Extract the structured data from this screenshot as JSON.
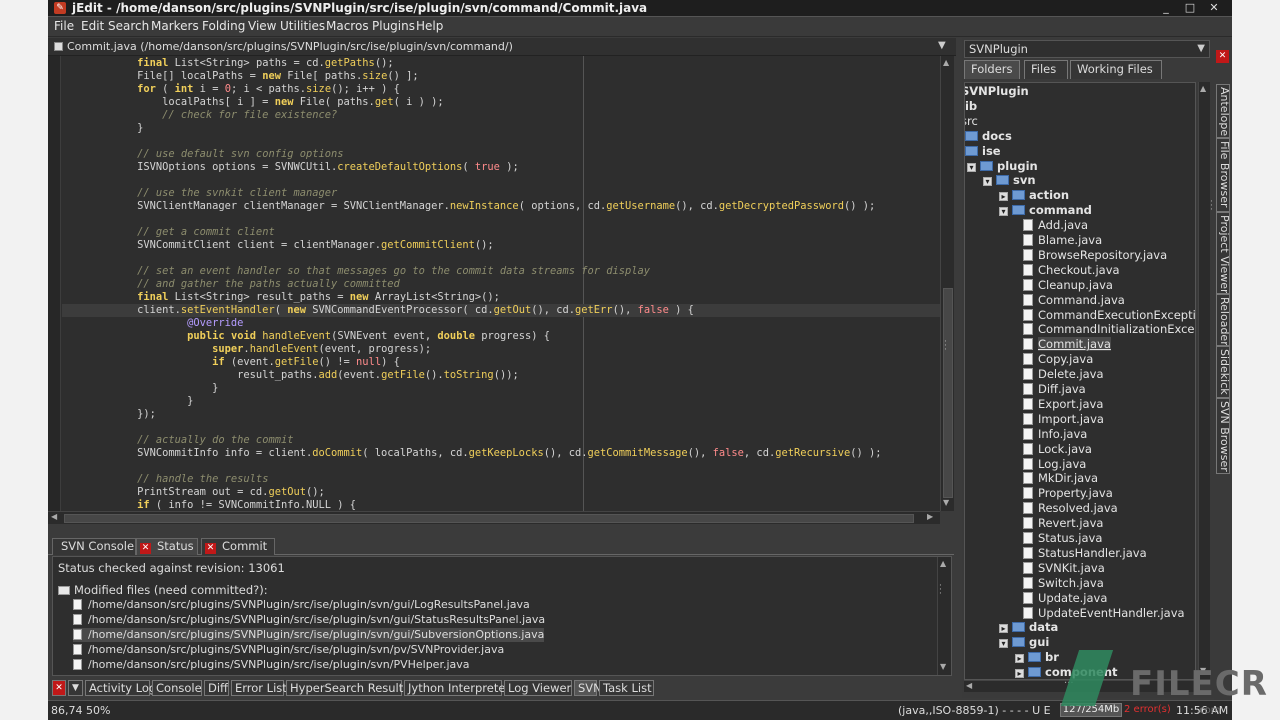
{
  "window": {
    "title": "jEdit - /home/danson/src/plugins/SVNPlugin/src/ise/plugin/svn/command/Commit.java",
    "app_icon": "jedit-logo-icon",
    "controls": [
      "_",
      "□",
      "✕"
    ]
  },
  "menu": [
    "File",
    "Edit",
    "Search",
    "Markers",
    "Folding",
    "View",
    "Utilities",
    "Macros",
    "Plugins",
    "Help"
  ],
  "buffer": {
    "path": "Commit.java (/home/danson/src/plugins/SVNPlugin/src/ise/plugin/svn/command/)"
  },
  "code_lines": [
    "            final List<String> paths = cd.getPaths();",
    "            File[] localPaths = new File[ paths.size() ];",
    "            for ( int i = 0; i < paths.size(); i++ ) {",
    "                localPaths[ i ] = new File( paths.get( i ) );",
    "                // check for file existence?",
    "            }",
    "",
    "            // use default svn config options",
    "            ISVNOptions options = SVNWCUtil.createDefaultOptions( true );",
    "",
    "            // use the svnkit client manager",
    "            SVNClientManager clientManager = SVNClientManager.newInstance( options, cd.getUsername(), cd.getDecryptedPassword() );",
    "",
    "            // get a commit client",
    "            SVNCommitClient client = clientManager.getCommitClient();",
    "",
    "            // set an event handler so that messages go to the commit data streams for display",
    "            // and gather the paths actually committed",
    "            final List<String> result_paths = new ArrayList<String>();",
    "            client.setEventHandler( new SVNCommandEventProcessor( cd.getOut(), cd.getErr(), false ) {",
    "                    @Override",
    "                    public void handleEvent(SVNEvent event, double progress) {",
    "                        super.handleEvent(event, progress);",
    "                        if (event.getFile() != null) {",
    "                            result_paths.add(event.getFile().toString());",
    "                        }",
    "                    }",
    "            });",
    "",
    "            // actually do the commit",
    "            SVNCommitInfo info = client.doCommit( localPaths, cd.getKeepLocks(), cd.getCommitMessage(), false, cd.getRecursive() );",
    "",
    "            // handle the results",
    "            PrintStream out = cd.getOut();",
    "            if ( info != SVNCommitInfo.NULL ) {"
  ],
  "highlight_line": 19,
  "bottom_tabs": [
    {
      "label": "SVN Console",
      "closable": false
    },
    {
      "label": "Status",
      "closable": true
    },
    {
      "label": "Commit",
      "closable": true
    }
  ],
  "status_panel": {
    "header": "Status checked against revision: 13061",
    "modified_label": "Modified files (need committed?):",
    "files": [
      "/home/danson/src/plugins/SVNPlugin/src/ise/plugin/svn/gui/LogResultsPanel.java",
      "/home/danson/src/plugins/SVNPlugin/src/ise/plugin/svn/gui/StatusResultsPanel.java",
      "/home/danson/src/plugins/SVNPlugin/src/ise/plugin/svn/gui/SubversionOptions.java",
      "/home/danson/src/plugins/SVNPlugin/src/ise/plugin/svn/pv/SVNProvider.java",
      "/home/danson/src/plugins/SVNPlugin/src/ise/plugin/svn/PVHelper.java"
    ],
    "selected_file": 2
  },
  "dock_buttons": [
    "Activity Log",
    "Console",
    "Diff",
    "Error List",
    "HyperSearch Results",
    "Jython Interpreter",
    "Log Viewer",
    "SVN",
    "Task List"
  ],
  "dock_selected": "SVN",
  "statusbar": {
    "position": "86,74 50%",
    "encoding": "(java,,ISO-8859-1)",
    "flags": "- - - - U E",
    "memory": "127/254Mb",
    "errors": "2 error(s)",
    "time": "11:56 AM"
  },
  "right_panel": {
    "plugin": "SVNPlugin",
    "tabs": [
      "Folders",
      "Files",
      "Working Files"
    ],
    "selected_tab": "Folders",
    "tree": [
      {
        "label": "SVNPlugin",
        "depth": 0,
        "kind": "text",
        "bold": true
      },
      {
        "label": "lib",
        "depth": 0,
        "kind": "text",
        "bold": true
      },
      {
        "label": "src",
        "depth": 0,
        "kind": "text",
        "bold": false
      },
      {
        "label": "docs",
        "depth": 0,
        "kind": "folder",
        "bold": true,
        "toggle": ""
      },
      {
        "label": "ise",
        "depth": 0,
        "kind": "folder",
        "bold": true,
        "toggle": ""
      },
      {
        "label": "plugin",
        "depth": 1,
        "kind": "folder",
        "bold": true,
        "toggle": "-"
      },
      {
        "label": "svn",
        "depth": 2,
        "kind": "folder",
        "bold": true,
        "toggle": "-"
      },
      {
        "label": "action",
        "depth": 3,
        "kind": "folder",
        "bold": true,
        "toggle": "+"
      },
      {
        "label": "command",
        "depth": 3,
        "kind": "folder",
        "bold": true,
        "toggle": "-"
      },
      {
        "label": "Add.java",
        "depth": 4,
        "kind": "file"
      },
      {
        "label": "Blame.java",
        "depth": 4,
        "kind": "file"
      },
      {
        "label": "BrowseRepository.java",
        "depth": 4,
        "kind": "file"
      },
      {
        "label": "Checkout.java",
        "depth": 4,
        "kind": "file"
      },
      {
        "label": "Cleanup.java",
        "depth": 4,
        "kind": "file"
      },
      {
        "label": "Command.java",
        "depth": 4,
        "kind": "file"
      },
      {
        "label": "CommandExecutionExceptio",
        "depth": 4,
        "kind": "file"
      },
      {
        "label": "CommandInitializationExcept",
        "depth": 4,
        "kind": "file"
      },
      {
        "label": "Commit.java",
        "depth": 4,
        "kind": "file",
        "selected": true
      },
      {
        "label": "Copy.java",
        "depth": 4,
        "kind": "file"
      },
      {
        "label": "Delete.java",
        "depth": 4,
        "kind": "file"
      },
      {
        "label": "Diff.java",
        "depth": 4,
        "kind": "file"
      },
      {
        "label": "Export.java",
        "depth": 4,
        "kind": "file"
      },
      {
        "label": "Import.java",
        "depth": 4,
        "kind": "file"
      },
      {
        "label": "Info.java",
        "depth": 4,
        "kind": "file"
      },
      {
        "label": "Lock.java",
        "depth": 4,
        "kind": "file"
      },
      {
        "label": "Log.java",
        "depth": 4,
        "kind": "file"
      },
      {
        "label": "MkDir.java",
        "depth": 4,
        "kind": "file"
      },
      {
        "label": "Property.java",
        "depth": 4,
        "kind": "file"
      },
      {
        "label": "Resolved.java",
        "depth": 4,
        "kind": "file"
      },
      {
        "label": "Revert.java",
        "depth": 4,
        "kind": "file"
      },
      {
        "label": "Status.java",
        "depth": 4,
        "kind": "file"
      },
      {
        "label": "StatusHandler.java",
        "depth": 4,
        "kind": "file"
      },
      {
        "label": "SVNKit.java",
        "depth": 4,
        "kind": "file"
      },
      {
        "label": "Switch.java",
        "depth": 4,
        "kind": "file"
      },
      {
        "label": "Update.java",
        "depth": 4,
        "kind": "file"
      },
      {
        "label": "UpdateEventHandler.java",
        "depth": 4,
        "kind": "file"
      },
      {
        "label": "data",
        "depth": 3,
        "kind": "folder",
        "bold": true,
        "toggle": "+"
      },
      {
        "label": "gui",
        "depth": 3,
        "kind": "folder",
        "bold": true,
        "toggle": "-"
      },
      {
        "label": "br",
        "depth": 4,
        "kind": "folder",
        "bold": true,
        "toggle": "+"
      },
      {
        "label": "component",
        "depth": 4,
        "kind": "folder",
        "bold": true,
        "toggle": "+"
      }
    ]
  },
  "right_dock": [
    "Antelope",
    "File Browser",
    "Project Viewer",
    "Reloader",
    "Sidekick",
    "SVN Browser"
  ],
  "watermark": {
    "word": "FILECR",
    "domain": ".com"
  }
}
